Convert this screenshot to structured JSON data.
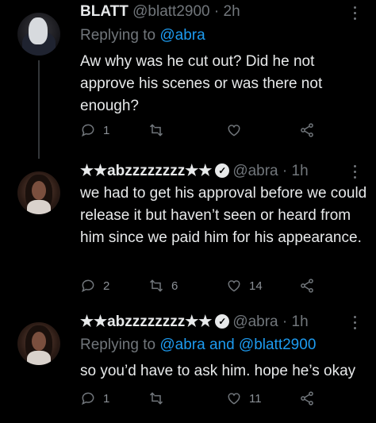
{
  "thread_line_color": "#333639",
  "tweets": [
    {
      "name": "BLATT",
      "handle": "@blatt2900",
      "sep": "·",
      "time": "2h",
      "replying_prefix": "Replying to ",
      "replying_handles": "@abra",
      "text": "Aw why was he cut out? Did he not approve his scenes or was there not enough?",
      "replies": "1",
      "retweets": "",
      "likes": "",
      "avatar_icon": "masked-figure-avatar"
    },
    {
      "name": "★★abzzzzzzzz★★",
      "handle": "@abra",
      "sep": "·",
      "time": "1h",
      "verified": "✓",
      "text": "we had to get his approval before we could release it but haven’t seen or heard from him since we paid him for his appearance.",
      "replies": "2",
      "retweets": "6",
      "likes": "14",
      "avatar_icon": "woman-selfie-avatar"
    },
    {
      "name": "★★abzzzzzzzz★★",
      "handle": "@abra",
      "sep": "·",
      "time": "1h",
      "verified": "✓",
      "replying_prefix": "Replying to ",
      "replying_handles": "@abra and @blatt2900",
      "text": "so you’d have to ask him. hope he’s okay",
      "replies": "1",
      "retweets": "",
      "likes": "11",
      "avatar_icon": "woman-selfie-avatar"
    }
  ]
}
